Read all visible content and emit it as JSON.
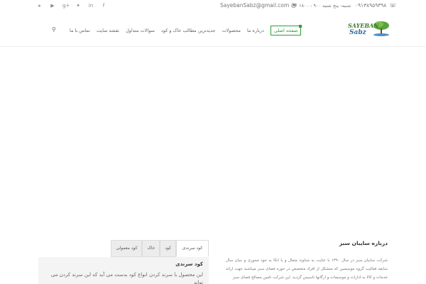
{
  "topbar": {
    "phone": "۰۹۱۳۸۹۵۹۳۹۸",
    "hours": "شنبه- پنج شنبه ۹۰۰ - ۱۸۰۰",
    "email": "SayebanSabz@gmail.com",
    "social_icons": [
      "flickr-icon",
      "youtube-icon",
      "google-plus-icon",
      "twitter-icon",
      "linkedin-icon",
      "facebook-icon"
    ]
  },
  "logo": {
    "line1": "SAYEBAN",
    "line2": "Sabz"
  },
  "nav": {
    "items": [
      {
        "label": "صفحه اصلی",
        "active": true
      },
      {
        "label": "درباره ما"
      },
      {
        "label": "محصولات"
      },
      {
        "label": "جدیدترین مطالب خاک و کود"
      },
      {
        "label": "سوالات متداول"
      },
      {
        "label": "نقشه سایت"
      },
      {
        "label": "تماس با ما"
      }
    ]
  },
  "tabs": {
    "items": [
      "کود سرندی",
      "کود",
      "خاک",
      "کود معمولی"
    ],
    "active_title": "کود سرندی",
    "active_text": "این محصول با سرند کردن انواع کود بدست می آید که این سرند کردن می تواند"
  },
  "about": {
    "title": "درباره سایبان سبز",
    "text": "شرکت سایبان سبز در سال ۱۳۹۰ با عنایت به شناوند متعال و با اتکا به خود محوری و بنیان سال سابقه فعالیت گروه موسسین که متشکل از افراد متخصص در حوزه فضای سبز میباشند جهت ارائه خدمات و کالا به ادارات و موسسات و ارگانها تاسیس گردید. این شرکت تامین مصالح فضای سبز"
  },
  "colors": {
    "accent": "#2a9d3a",
    "logo_green": "#3d7b2b",
    "logo_blue": "#2c6aa0"
  }
}
